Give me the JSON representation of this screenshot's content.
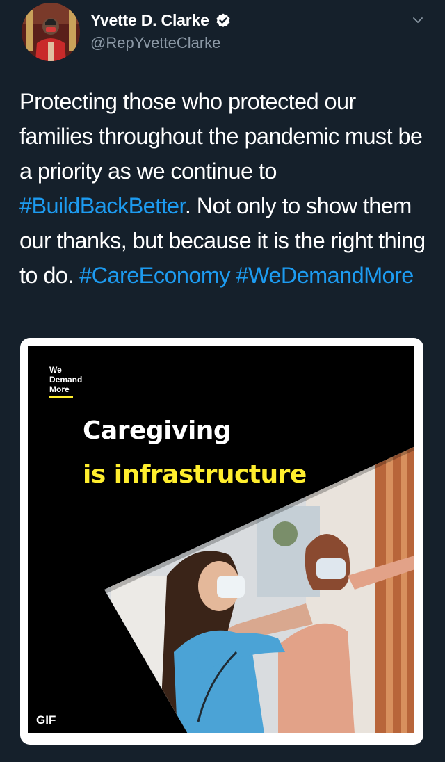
{
  "author": {
    "display_name": "Yvette D. Clarke",
    "handle": "@RepYvetteClarke",
    "verified": true,
    "avatar_icon": "profile-photo"
  },
  "menu_icon": "chevron-down-icon",
  "tweet": {
    "segments": [
      {
        "text": "Protecting those who protected our families throughout the pandemic must be a priority as we continue to ",
        "type": "text"
      },
      {
        "text": "#BuildBackBetter",
        "type": "hashtag"
      },
      {
        "text": ". Not only to show them our thanks, but because it is the right thing to do. ",
        "type": "text"
      },
      {
        "text": "#CareEconomy",
        "type": "hashtag"
      },
      {
        "text": " ",
        "type": "text"
      },
      {
        "text": "#WeDemandMore",
        "type": "hashtag"
      }
    ]
  },
  "media": {
    "brand_line1": "We",
    "brand_line2": "Demand",
    "brand_line3": "More",
    "headline_line1": "Caregiving",
    "headline_line2": "is infrastructure",
    "badge": "GIF"
  },
  "colors": {
    "background": "#15202b",
    "hashtag": "#1d9bf0",
    "secondary_text": "#8b98a5",
    "accent_yellow": "#ffee2e"
  }
}
